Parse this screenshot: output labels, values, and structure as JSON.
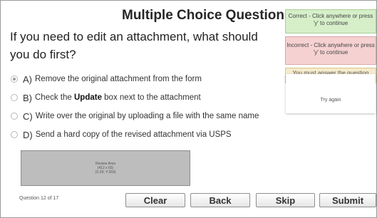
{
  "slide": {
    "title": "Multiple Choice Question",
    "question": "If you need to edit an attachment, what should you do first?",
    "options": [
      {
        "letter": "A)",
        "text": "Remove the original attachment from the form"
      },
      {
        "letter": "B)",
        "pre": "Check the ",
        "bold": "Update",
        "post": " box next to the attachment"
      },
      {
        "letter": "C)",
        "text": "Write over the original by uploading a file with the same name"
      },
      {
        "letter": "D)",
        "text": "Send a hard copy of the revised attachment via USPS"
      }
    ],
    "review_area": {
      "line1": "Review Area",
      "line2": "(412 x 65)",
      "line3": "(X:29; Y:269)"
    },
    "counter": "Question 12 of 17"
  },
  "buttons": {
    "clear": "Clear",
    "back": "Back",
    "skip": "Skip",
    "submit": "Submit"
  },
  "feedback": {
    "correct": "Correct - Click anywhere or press 'y' to continue",
    "incorrect": "Incorrect - Click anywhere or press 'y' to continue",
    "must_answer": "You must answer the question before continuing",
    "try_again": "Try again"
  },
  "colors": {
    "correct_bg": "#d6efc9",
    "incorrect_bg": "#f6d1d1",
    "warning_bg": "#f6ebcc"
  }
}
